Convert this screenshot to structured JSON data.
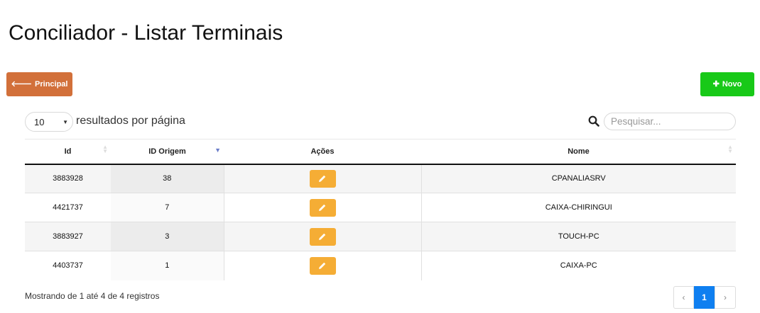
{
  "page": {
    "title": "Conciliador - Listar Terminais"
  },
  "toolbar": {
    "back_label": "Principal",
    "new_label": "Novo",
    "back_color": "#d2703a",
    "new_color": "#18c918"
  },
  "controls": {
    "length_value": "10",
    "length_label": "resultados por página",
    "search_placeholder": "Pesquisar..."
  },
  "table": {
    "columns": [
      "Id",
      "ID Origem",
      "Ações",
      "Nome"
    ],
    "sorted_column": "ID Origem",
    "rows": [
      {
        "id": "3883928",
        "origem": "38",
        "nome": "CPANALIASRV"
      },
      {
        "id": "4421737",
        "origem": "7",
        "nome": "CAIXA-CHIRINGUI"
      },
      {
        "id": "3883927",
        "origem": "3",
        "nome": "TOUCH-PC"
      },
      {
        "id": "4403737",
        "origem": "1",
        "nome": "CAIXA-PC"
      }
    ],
    "edit_color": "#f5ad35"
  },
  "footer": {
    "info": "Mostrando de 1 até 4 de 4 registros",
    "prev": "‹",
    "current_page": "1",
    "next": "›",
    "active_color": "#0f7ff0"
  }
}
